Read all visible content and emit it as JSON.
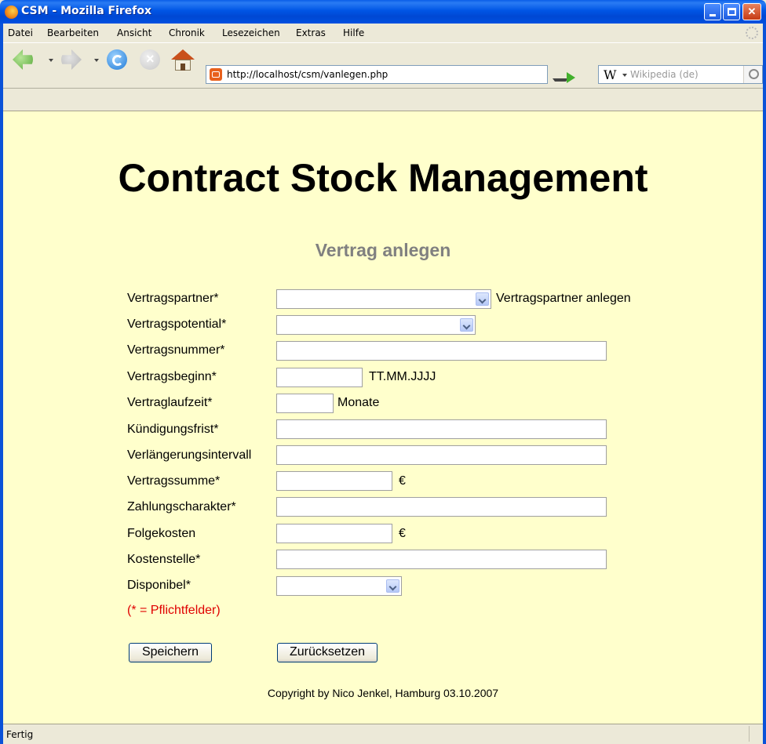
{
  "window": {
    "title": "CSM - Mozilla Firefox"
  },
  "menu": [
    "Datei",
    "Bearbeiten",
    "Ansicht",
    "Chronik",
    "Lesezeichen",
    "Extras",
    "Hilfe"
  ],
  "navigation": {
    "url": "http://localhost/csm/vanlegen.php",
    "search_placeholder": "Wikipedia (de)",
    "search_engine_glyph": "W"
  },
  "page": {
    "title": "Contract Stock Management",
    "subtitle": "Vertrag anlegen",
    "fields": [
      {
        "label": "Vertragspartner*",
        "type": "select",
        "value": "",
        "suffix": "Vertragspartner anlegen"
      },
      {
        "label": "Vertragspotential*",
        "type": "select",
        "value": "",
        "suffix": ""
      },
      {
        "label": "Vertragsnummer*",
        "type": "text",
        "value": "",
        "suffix": ""
      },
      {
        "label": "Vertragsbeginn*",
        "type": "text",
        "value": "",
        "suffix": "TT.MM.JJJJ"
      },
      {
        "label": "Vertraglaufzeit*",
        "type": "text",
        "value": "",
        "suffix": "Monate"
      },
      {
        "label": "Kündigungsfrist*",
        "type": "text",
        "value": "",
        "suffix": ""
      },
      {
        "label": "Verlängerungsintervall",
        "type": "text",
        "value": "",
        "suffix": ""
      },
      {
        "label": "Vertragssumme*",
        "type": "text",
        "value": "",
        "suffix": "€"
      },
      {
        "label": "Zahlungscharakter*",
        "type": "text",
        "value": "",
        "suffix": ""
      },
      {
        "label": "Folgekosten",
        "type": "text",
        "value": "",
        "suffix": "€"
      },
      {
        "label": "Kostenstelle*",
        "type": "text",
        "value": "",
        "suffix": ""
      },
      {
        "label": "Disponibel*",
        "type": "select",
        "value": "",
        "suffix": ""
      }
    ],
    "required_note": "(* = Pflichtfelder)",
    "save_label": "Speichern",
    "reset_label": "Zurücksetzen",
    "copyright": "Copyright by Nico Jenkel, Hamburg 03.10.2007"
  },
  "status": {
    "text": "Fertig"
  },
  "colors": {
    "page_background": "#ffffcc",
    "subtitle": "#808080",
    "required_note": "#e00000",
    "titlebar": "#0055e5"
  }
}
